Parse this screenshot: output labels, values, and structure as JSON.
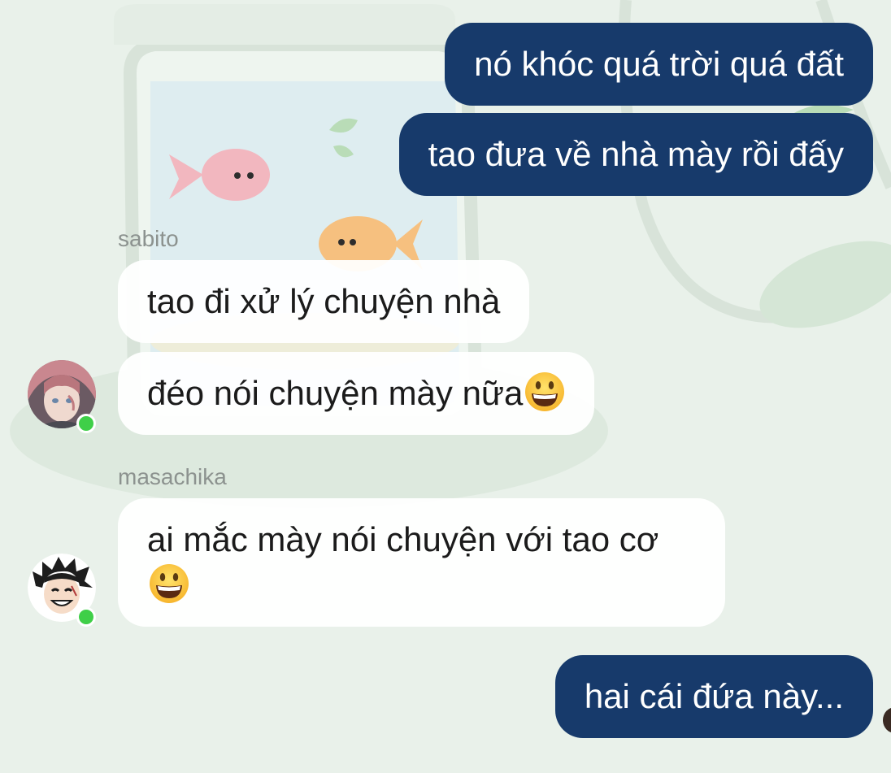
{
  "theme": {
    "outgoing_bubble": "#173a6b",
    "incoming_bubble": "#ffffff",
    "background": "#e9f1ea",
    "online_dot": "#3fcf48"
  },
  "messages": [
    {
      "direction": "outgoing",
      "text": "nó khóc quá trời quá đất"
    },
    {
      "direction": "outgoing",
      "text": "tao đưa về nhà mày rồi đấy"
    },
    {
      "direction": "incoming",
      "sender": "sabito",
      "text": "tao đi xử lý chuyện nhà"
    },
    {
      "direction": "incoming",
      "sender": "sabito",
      "text": "đéo nói chuyện mày nữa",
      "emoji": "grinning-face-emoji"
    },
    {
      "direction": "incoming",
      "sender": "masachika",
      "text": "ai mắc mày nói chuyện với tao cơ",
      "emoji": "grinning-face-emoji"
    },
    {
      "direction": "outgoing",
      "text": "hai cái đứa này..."
    }
  ]
}
